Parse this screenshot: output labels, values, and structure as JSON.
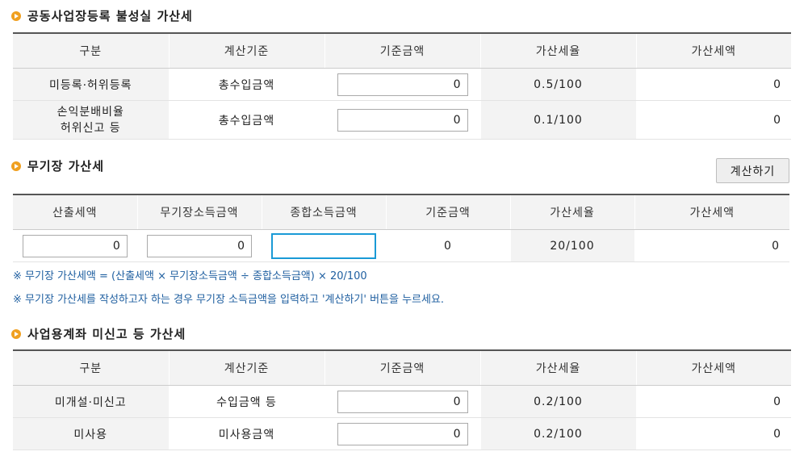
{
  "section1": {
    "title": "공동사업장등록 불성실 가산세",
    "headers": [
      "구분",
      "계산기준",
      "기준금액",
      "가산세율",
      "가산세액"
    ],
    "rows": [
      {
        "label": "미등록·허위등록",
        "basis": "총수입금액",
        "input": "0",
        "rate": "0.5/100",
        "amount": "0"
      },
      {
        "label_line1": "손익분배비율",
        "label_line2": "허위신고 등",
        "basis": "총수입금액",
        "input": "0",
        "rate": "0.1/100",
        "amount": "0"
      }
    ]
  },
  "section2": {
    "title": "무기장 가산세",
    "calc_button": "계산하기",
    "headers": [
      "산출세액",
      "무기장소득금액",
      "종합소득금액",
      "기준금액",
      "가산세율",
      "가산세액"
    ],
    "row": {
      "calc_tax": "0",
      "unrecorded_income": "0",
      "total_income": "",
      "base_amount": "0",
      "rate": "20/100",
      "amount": "0"
    },
    "note1": "※ 무기장 가산세액 = (산출세액 × 무기장소득금액 ÷ 종합소득금액) × 20/100",
    "note2": "※ 무기장 가산세를 작성하고자 하는 경우 무기장 소득금액을 입력하고 '계산하기' 버튼을 누르세요."
  },
  "section3": {
    "title": "사업용계좌 미신고 등 가산세",
    "headers": [
      "구분",
      "계산기준",
      "기준금액",
      "가산세율",
      "가산세액"
    ],
    "rows": [
      {
        "label": "미개설·미신고",
        "basis": "수입금액 등",
        "input": "0",
        "rate": "0.2/100",
        "amount": "0"
      },
      {
        "label": "미사용",
        "basis": "미사용금액",
        "input": "0",
        "rate": "0.2/100",
        "amount": "0"
      }
    ]
  }
}
